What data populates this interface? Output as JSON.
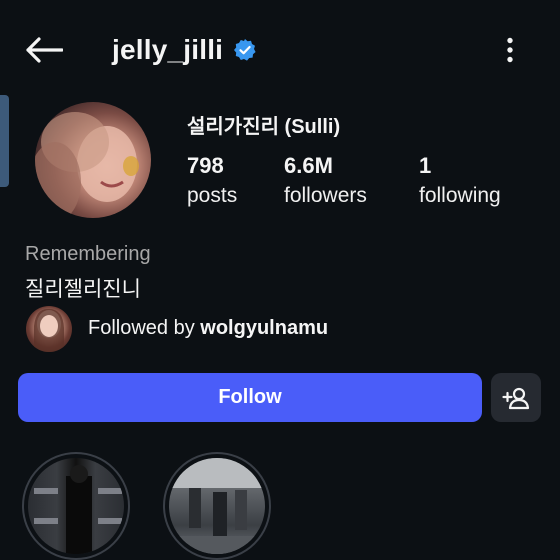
{
  "header": {
    "username": "jelly_jilli",
    "verified_icon": "verified-badge-icon",
    "back_icon": "arrow-left-icon",
    "more_icon": "more-vertical-icon"
  },
  "profile": {
    "display_name": "설리가진리 (Sulli)",
    "stats": [
      {
        "value": "798",
        "label": "posts"
      },
      {
        "value": "6.6M",
        "label": "followers"
      },
      {
        "value": "1",
        "label": "following"
      }
    ],
    "bio_label": "Remembering",
    "bio_text": "질리젤리진니",
    "followed_by_prefix": "Followed by ",
    "followed_by_user": "wolgyulnamu"
  },
  "actions": {
    "follow_label": "Follow",
    "add_user_icon": "add-person-icon"
  },
  "colors": {
    "background": "#0c1014",
    "accent": "#4a5df9",
    "verified": "#3897f0",
    "secondary_text": "#a8a8a8"
  }
}
